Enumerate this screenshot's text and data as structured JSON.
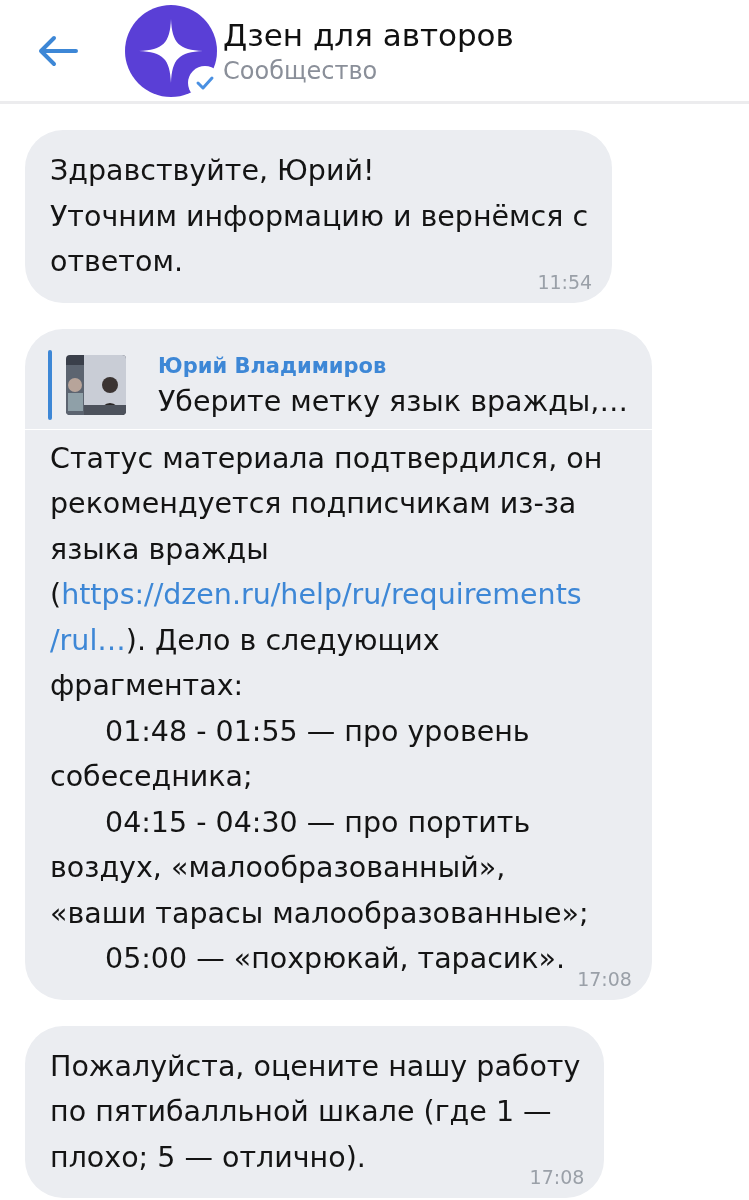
{
  "header": {
    "title": "Дзен для авторов",
    "subtitle": "Сообщество",
    "verified": true
  },
  "messages": [
    {
      "lines": [
        {
          "text": "Здравствуйте, Юрий!"
        },
        {
          "text": "Уточним информацию и вернёмся с"
        },
        {
          "text": "ответом."
        }
      ],
      "time": "11:54"
    },
    {
      "quote": {
        "author": "Юрий Владимиров",
        "text": "Уберите метку язык вражды,…"
      },
      "lines": [
        {
          "text": "Статус материала подтвердился, он"
        },
        {
          "text": "рекомендуется подписчикам из-за"
        },
        {
          "text": "языка вражды"
        },
        {
          "parts": [
            {
              "kind": "text",
              "text": "("
            },
            {
              "kind": "link",
              "text": "https://dzen.ru/help/ru/requirements"
            }
          ]
        },
        {
          "parts": [
            {
              "kind": "link",
              "text": "/rul…"
            },
            {
              "kind": "text",
              "text": "). Дело в следующих"
            }
          ]
        },
        {
          "text": "фрагментах:"
        },
        {
          "text": "01:48 - 01:55 — про уровень",
          "indent": true
        },
        {
          "text": "собеседника;"
        },
        {
          "text": "04:15 - 04:30 — про портить",
          "indent": true
        },
        {
          "text": "воздух, «малообразованный»,"
        },
        {
          "text": "«ваши тарасы малообразованные»;"
        },
        {
          "text": "05:00 — «похрюкай, тарасик».",
          "indent": true
        }
      ],
      "time": "17:08"
    },
    {
      "lines": [
        {
          "text": "Пожалуйста, оцените нашу работу"
        },
        {
          "text": "по пятибалльной шкале (где 1 —"
        },
        {
          "text": "плохо; 5 — отлично)."
        }
      ],
      "time": "17:08"
    }
  ]
}
